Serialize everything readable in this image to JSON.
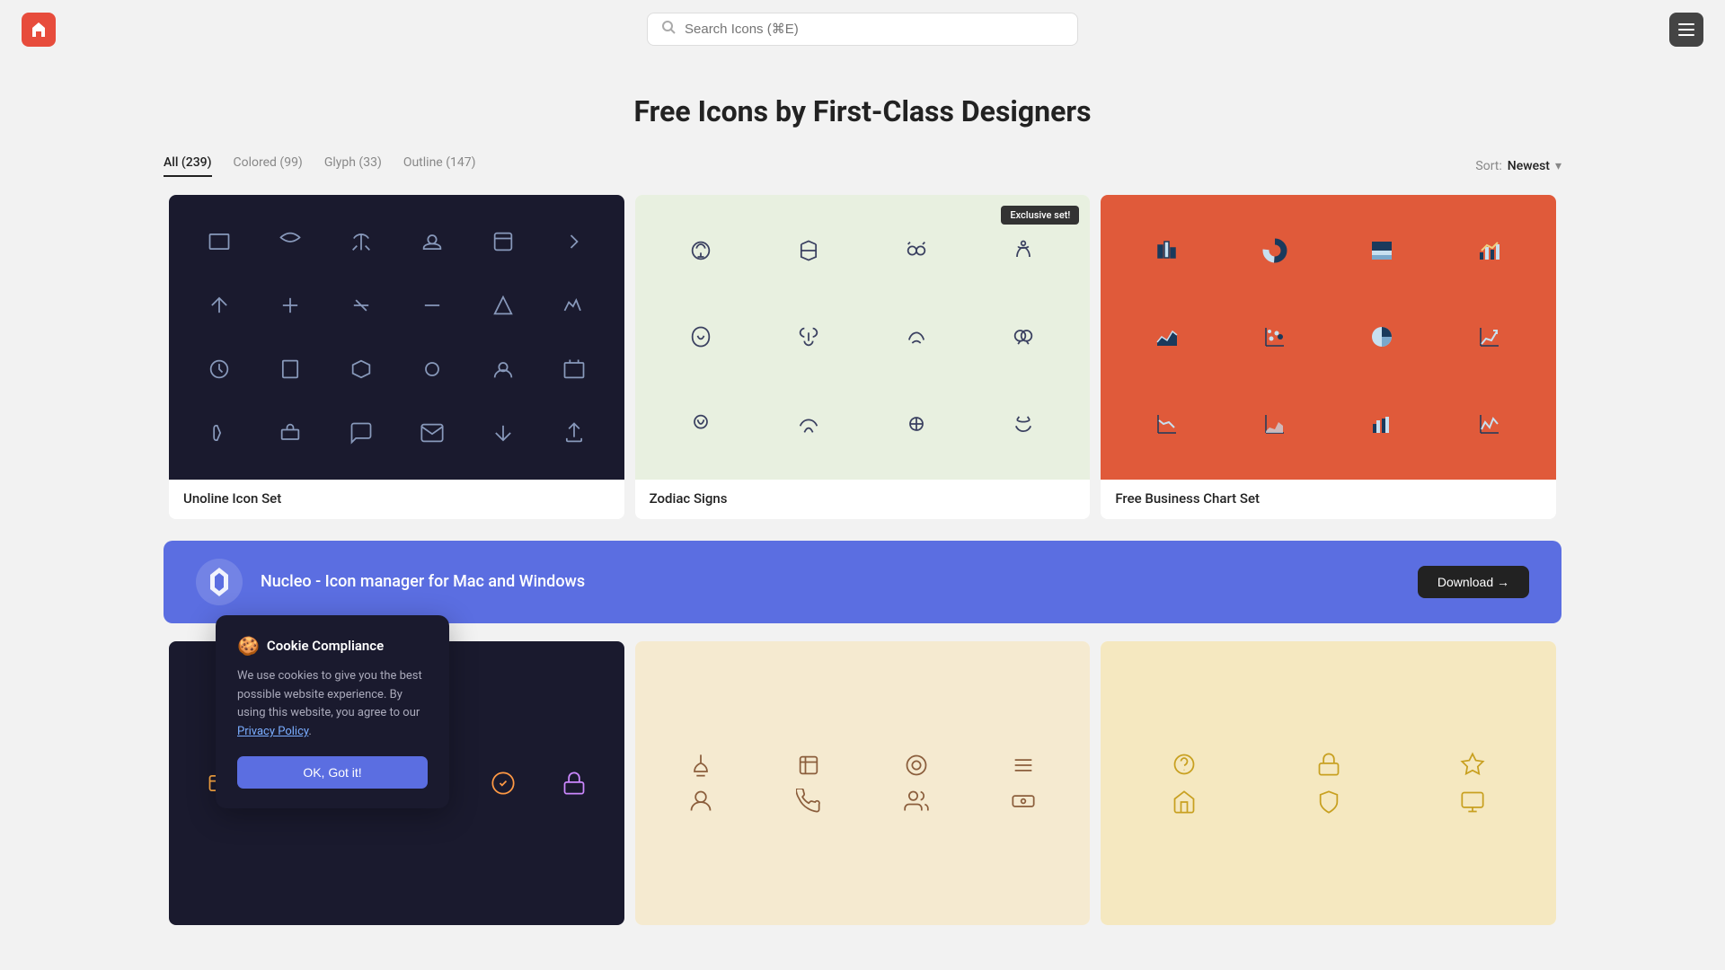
{
  "header": {
    "logo_emoji": "🏠",
    "search_placeholder": "Search Icons (⌘E)",
    "menu_label": "Menu"
  },
  "page_title": "Free Icons by First-Class Designers",
  "tabs": [
    {
      "label": "All (239)",
      "active": true
    },
    {
      "label": "Colored (99)",
      "active": false
    },
    {
      "label": "Glyph (33)",
      "active": false
    },
    {
      "label": "Outline (147)",
      "active": false
    }
  ],
  "sort": {
    "label": "Sort:",
    "value": "Newest"
  },
  "cards": [
    {
      "id": "unoline",
      "theme": "dark",
      "label": "Unoline Icon Set",
      "exclusive": false
    },
    {
      "id": "zodiac",
      "theme": "light-green",
      "label": "Zodiac Signs",
      "exclusive": true,
      "exclusive_text": "Exclusive set!"
    },
    {
      "id": "business-chart",
      "theme": "orange-red",
      "label": "Free Business Chart Set",
      "exclusive": false
    }
  ],
  "banner": {
    "text": "Nucleo - Icon manager for Mac and Windows",
    "button_label": "Download →"
  },
  "cards_row2": [
    {
      "id": "dark-icons-2",
      "theme": "dark2",
      "label": ""
    },
    {
      "id": "colored-icons",
      "theme": "peach",
      "label": ""
    },
    {
      "id": "gold-icons",
      "theme": "gold",
      "label": ""
    }
  ],
  "cookie": {
    "emoji": "🍪",
    "title": "Cookie Compliance",
    "body": "We use cookies to give you the best possible website experience. By using this website, you agree to our ",
    "link_text": "Privacy Policy",
    "button_label": "OK, Got it!"
  }
}
